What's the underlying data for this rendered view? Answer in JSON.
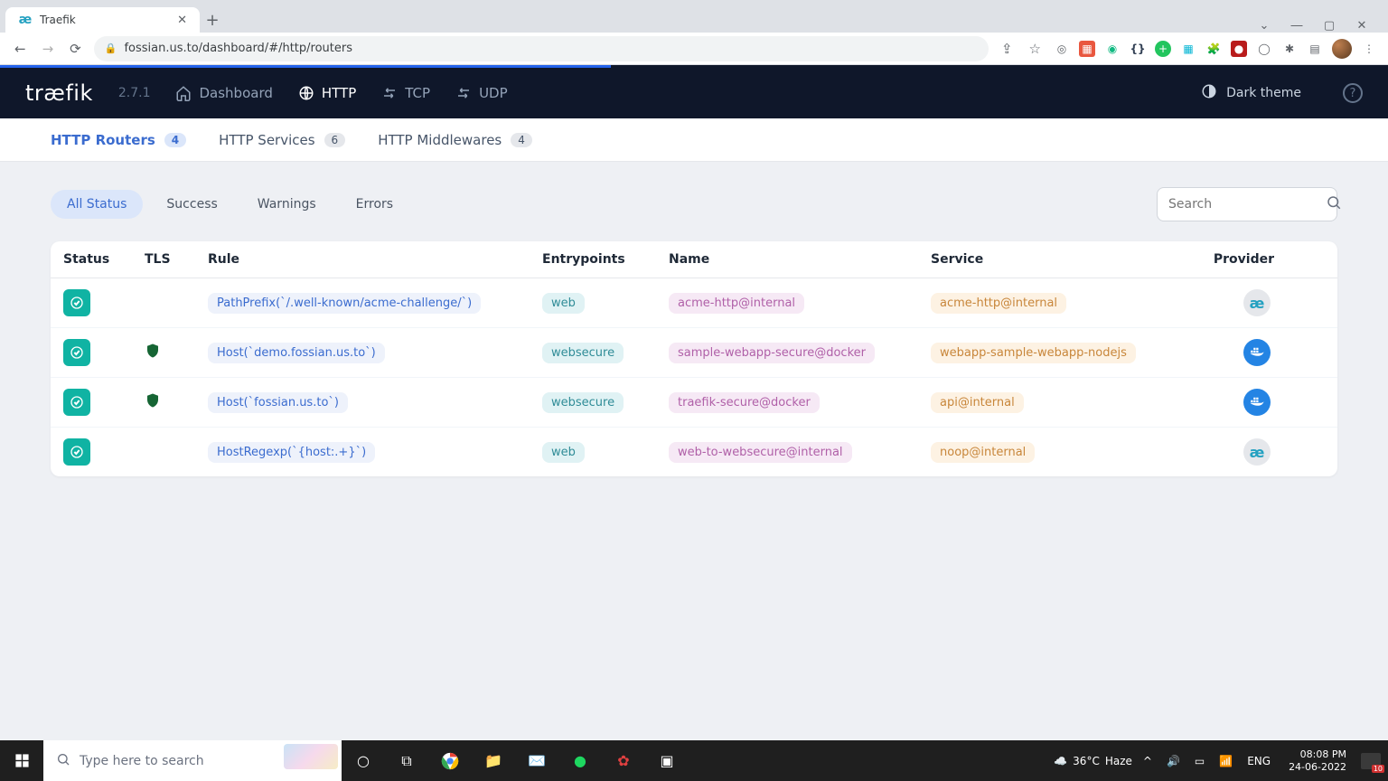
{
  "browser": {
    "tab_title": "Traefik",
    "url": "fossian.us.to/dashboard/#/http/routers"
  },
  "app": {
    "logo": "træfik",
    "version": "2.7.1",
    "nav": {
      "dashboard": "Dashboard",
      "http": "HTTP",
      "tcp": "TCP",
      "udp": "UDP"
    },
    "dark_theme_label": "Dark theme"
  },
  "subnav": {
    "routers": {
      "label": "HTTP Routers",
      "count": "4"
    },
    "services": {
      "label": "HTTP Services",
      "count": "6"
    },
    "middlewares": {
      "label": "HTTP Middlewares",
      "count": "4"
    }
  },
  "filters": {
    "all": "All Status",
    "success": "Success",
    "warnings": "Warnings",
    "errors": "Errors",
    "search_placeholder": "Search"
  },
  "table": {
    "headers": {
      "status": "Status",
      "tls": "TLS",
      "rule": "Rule",
      "entrypoints": "Entrypoints",
      "name": "Name",
      "service": "Service",
      "provider": "Provider"
    },
    "rows": [
      {
        "tls": false,
        "rule": "PathPrefix(`/.well-known/acme-challenge/`)",
        "entry": "web",
        "name": "acme-http@internal",
        "service": "acme-http@internal",
        "provider": "internal"
      },
      {
        "tls": true,
        "rule": "Host(`demo.fossian.us.to`)",
        "entry": "websecure",
        "name": "sample-webapp-secure@docker",
        "service": "webapp-sample-webapp-nodejs",
        "provider": "docker"
      },
      {
        "tls": true,
        "rule": "Host(`fossian.us.to`)",
        "entry": "websecure",
        "name": "traefik-secure@docker",
        "service": "api@internal",
        "provider": "docker"
      },
      {
        "tls": false,
        "rule": "HostRegexp(`{host:.+}`)",
        "entry": "web",
        "name": "web-to-websecure@internal",
        "service": "noop@internal",
        "provider": "internal"
      }
    ]
  },
  "taskbar": {
    "search_placeholder": "Type here to search",
    "weather_temp": "36°C",
    "weather_cond": "Haze",
    "lang": "ENG",
    "time": "08:08 PM",
    "date": "24-06-2022"
  }
}
